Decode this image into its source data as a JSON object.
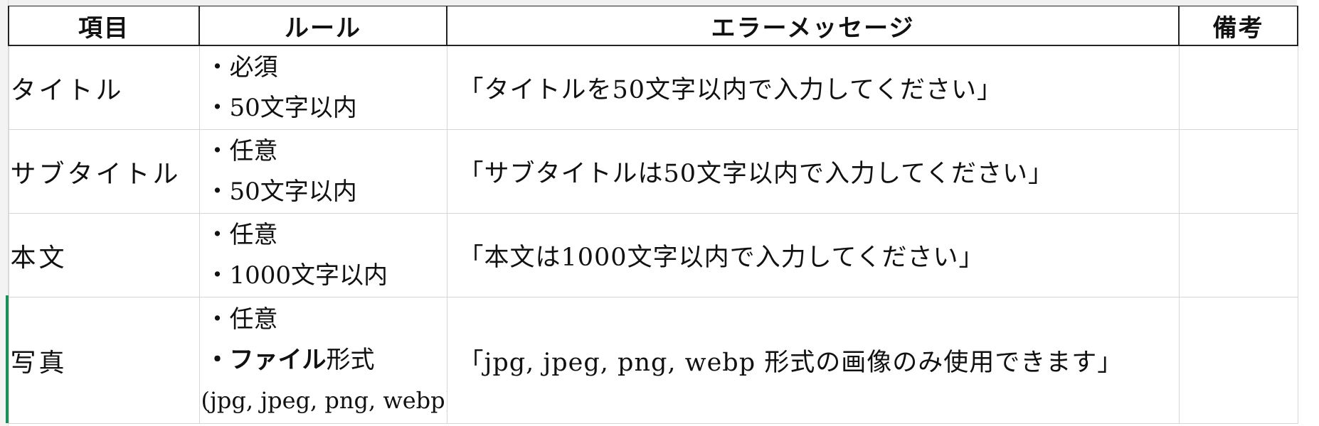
{
  "table": {
    "headers": [
      "項目",
      "ルール",
      "エラーメッセージ",
      "備考"
    ],
    "rows": [
      {
        "item": "タイトル",
        "rules": [
          "・必須",
          "・50文字以内"
        ],
        "message": "「タイトルを50文字以内で入力してください」",
        "note": ""
      },
      {
        "item": "サブタイトル",
        "rules": [
          "・任意",
          "・50文字以内"
        ],
        "message": "「サブタイトルは50文字以内で入力してください」",
        "note": ""
      },
      {
        "item": "本文",
        "rules": [
          "・任意",
          "・1000文字以内"
        ],
        "message": "「本文は1000文字以内で入力してください」",
        "note": ""
      },
      {
        "item": "写真",
        "rules": [
          "・任意"
        ],
        "rule_file_bold": "・ファイル",
        "rule_file_rest": "形式",
        "rule_file_types": "(jpg, jpeg, png, webp)",
        "message": "「jpg, jpeg, png, webp 形式の画像のみ使用できます」",
        "note": ""
      }
    ]
  },
  "colors": {
    "selection": "#1a8f5a",
    "grid_line": "#d6d6d6",
    "header_border": "#222222"
  }
}
